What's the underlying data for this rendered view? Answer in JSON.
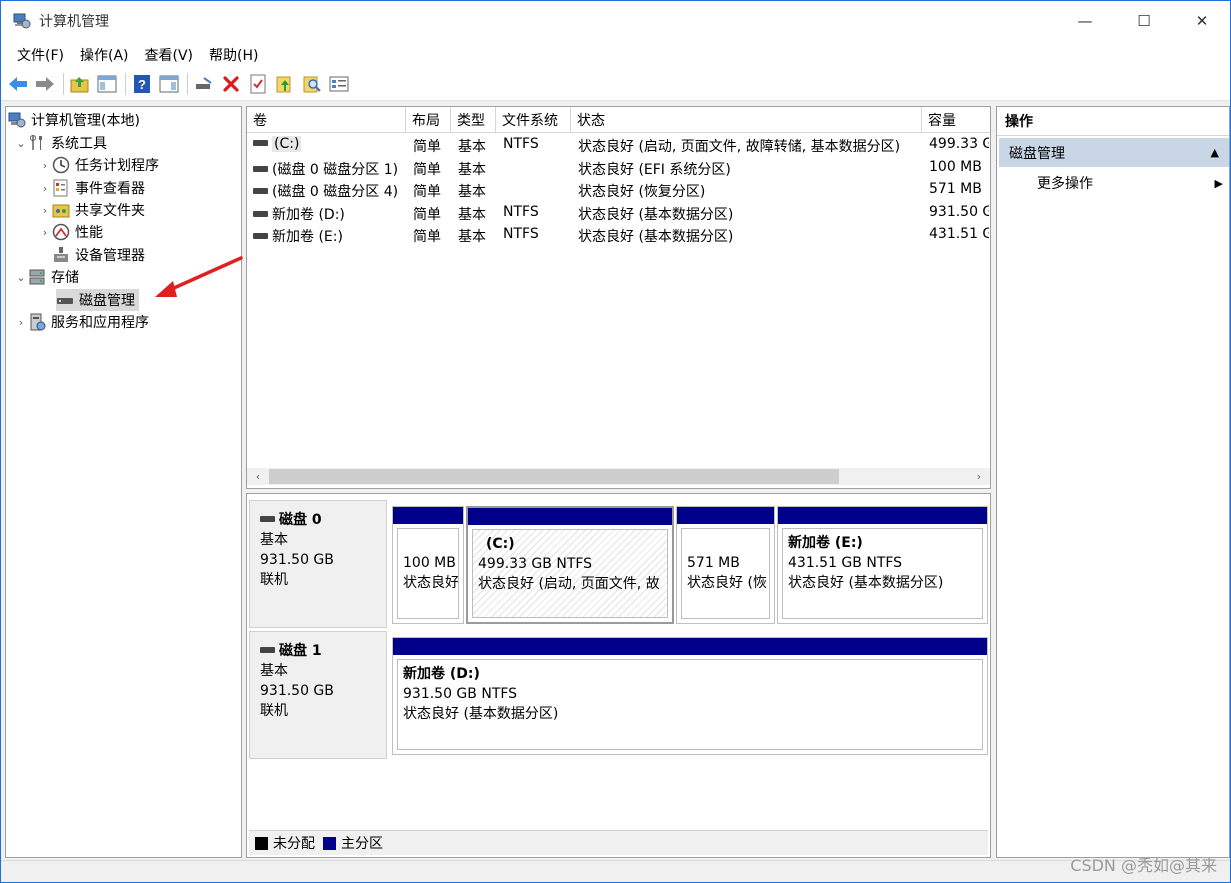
{
  "window": {
    "title": "计算机管理",
    "controls": {
      "minimize": "—",
      "maximize": "☐",
      "close": "✕"
    }
  },
  "menu": [
    "文件(F)",
    "操作(A)",
    "查看(V)",
    "帮助(H)"
  ],
  "tree": {
    "root": "计算机管理(本地)",
    "system_tools": "系统工具",
    "task_scheduler": "任务计划程序",
    "event_viewer": "事件查看器",
    "shared_folders": "共享文件夹",
    "performance": "性能",
    "device_manager": "设备管理器",
    "storage": "存储",
    "disk_management": "磁盘管理",
    "services": "服务和应用程序"
  },
  "volume_table": {
    "headers": [
      "卷",
      "布局",
      "类型",
      "文件系统",
      "状态",
      "容量"
    ],
    "rows": [
      [
        "(C:)",
        "简单",
        "基本",
        "NTFS",
        "状态良好 (启动, 页面文件, 故障转储, 基本数据分区)",
        "499.33 G"
      ],
      [
        "(磁盘 0 磁盘分区 1)",
        "简单",
        "基本",
        "",
        "状态良好 (EFI 系统分区)",
        "100 MB"
      ],
      [
        "(磁盘 0 磁盘分区 4)",
        "简单",
        "基本",
        "",
        "状态良好 (恢复分区)",
        "571 MB"
      ],
      [
        "新加卷 (D:)",
        "简单",
        "基本",
        "NTFS",
        "状态良好 (基本数据分区)",
        "931.50 G"
      ],
      [
        "新加卷 (E:)",
        "简单",
        "基本",
        "NTFS",
        "状态良好 (基本数据分区)",
        "431.51 G"
      ]
    ]
  },
  "disk0": {
    "name": "磁盘 0",
    "type": "基本",
    "size": "931.50 GB",
    "status": "联机",
    "p1": {
      "l1": "100 MB",
      "l2": "状态良好"
    },
    "p2": {
      "title": "(C:)",
      "l1": "499.33 GB NTFS",
      "l2": "状态良好 (启动, 页面文件, 故"
    },
    "p3": {
      "l1": "571 MB",
      "l2": "状态良好 (恢"
    },
    "p4": {
      "title": "新加卷 (E:)",
      "l1": "431.51 GB NTFS",
      "l2": "状态良好 (基本数据分区)"
    }
  },
  "disk1": {
    "name": "磁盘 1",
    "type": "基本",
    "size": "931.50 GB",
    "status": "联机",
    "p1": {
      "title": "新加卷 (D:)",
      "l1": "931.50 GB NTFS",
      "l2": "状态良好 (基本数据分区)"
    }
  },
  "legend": {
    "unallocated": "未分配",
    "primary": "主分区"
  },
  "actions": {
    "header": "操作",
    "section": "磁盘管理",
    "more": "更多操作"
  },
  "watermark": "CSDN @秃如@其来",
  "colors": {
    "partition_bar": "#00008b",
    "selection": "#d9d9d9",
    "actions_section": "#c8d6e5",
    "annotation_arrow": "#e02020"
  }
}
